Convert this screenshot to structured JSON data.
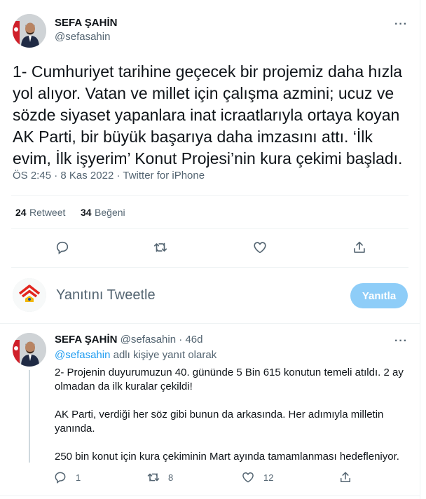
{
  "tweet": {
    "display_name": "SEFA ŞAHİN",
    "handle": "@sefasahin",
    "more": "···",
    "text": "1- Cumhuriyet tarihine geçecek bir projemiz daha hızla yol alıyor. Vatan ve millet için çalışma azmini; ucuz ve sözde siyaset yapanlara inat icraatlarıyla ortaya koyan AK Parti, bir büyük başarıya daha imzasını attı. ‘İlk evim, İlk işyerim’ Konut Projesi’nin kura çekimi başladı.",
    "time": "ÖS 2:45",
    "sep1": " · ",
    "date": "8 Kas 2022",
    "sep2": " · ",
    "source": "Twitter for iPhone",
    "retweets": "24",
    "retweets_label": "Retweet",
    "likes": "34",
    "likes_label": "Beğeni"
  },
  "compose": {
    "placeholder": "Yanıtını Tweetle",
    "button": "Yanıtla"
  },
  "reply": {
    "display_name": "SEFA ŞAHİN",
    "handle": "@sefasahin",
    "dot": " · ",
    "age": "46d",
    "more": "···",
    "replying_to": "@sefasahin",
    "replying_suffix": " adlı kişiye yanıt olarak",
    "paragraphs": [
      "2- Projenin duyurumuzun 40. gününde 5 Bin 615 konutun temeli atıldı. 2 ay olmadan da ilk kuralar çekildi!",
      "AK Parti, verdiği her söz gibi bunun da arkasında. Her adımıyla milletin yanında.",
      "250 bin konut için kura çekiminin Mart ayında tamamlanması hedefleniyor."
    ],
    "reply_count": "1",
    "retweet_count": "8",
    "like_count": "12"
  },
  "colors": {
    "accent": "#1d9bf0",
    "button_disabled": "#8ecdf8",
    "text": "#0f1419",
    "secondary": "#536471",
    "border": "#eff3f4"
  },
  "icons": [
    "reply-icon",
    "retweet-icon",
    "like-icon",
    "share-icon",
    "more-icon",
    "akp-logo-avatar"
  ]
}
